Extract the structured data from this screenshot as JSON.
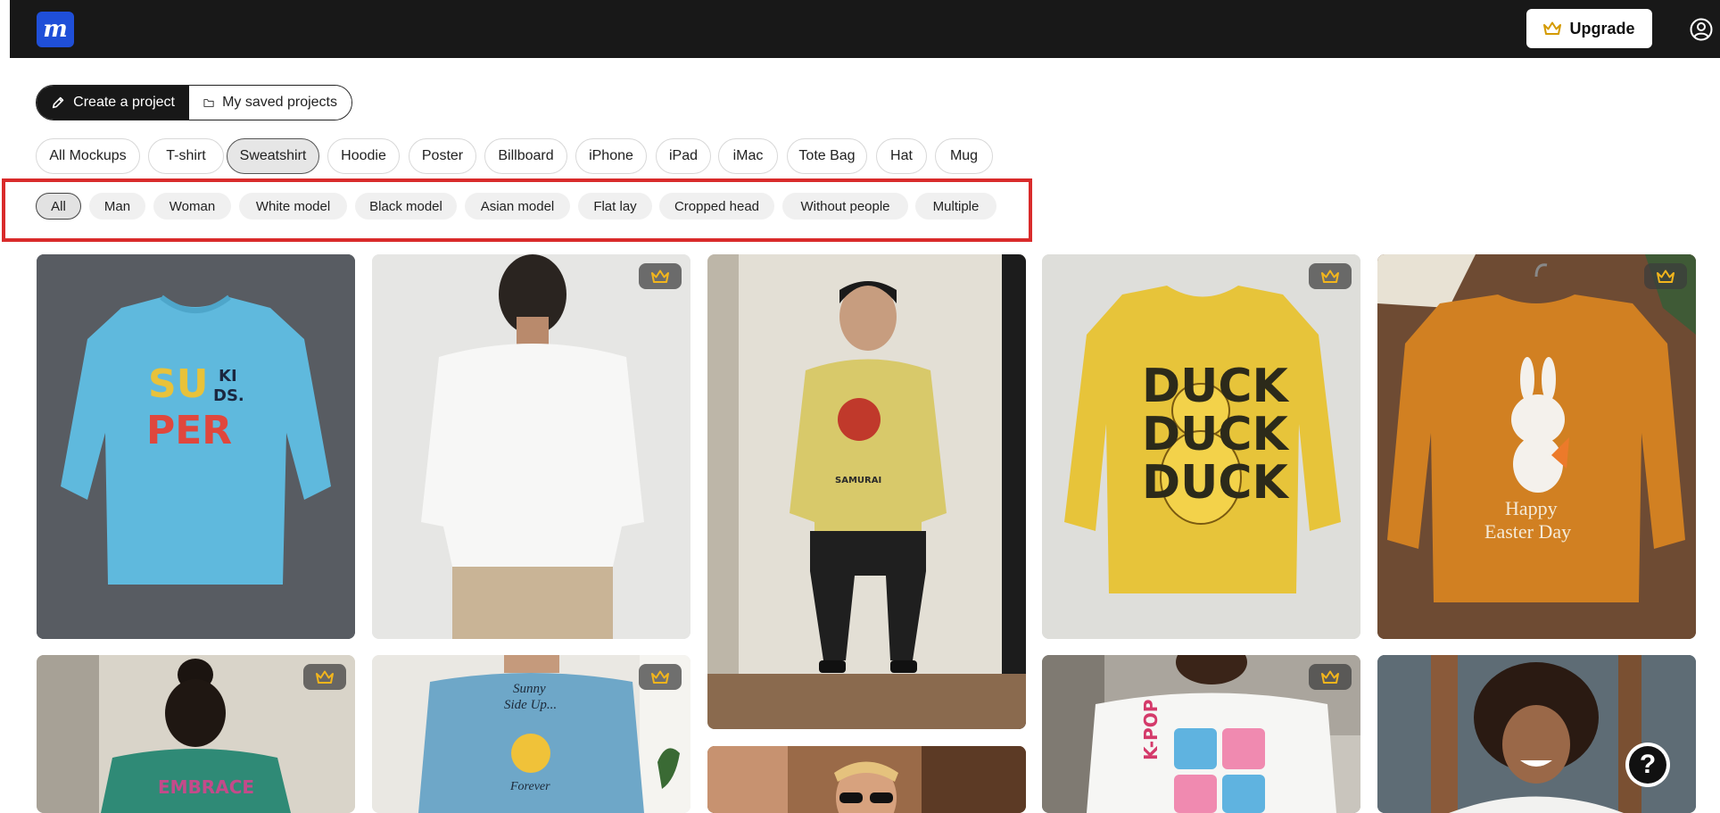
{
  "header": {
    "logo_letter": "m",
    "upgrade_label": "Upgrade",
    "logo_icon": "brand-logo-icon",
    "upgrade_icon": "crown-icon",
    "account_icon": "user-circle-icon"
  },
  "project_tabs": [
    {
      "label": "Create a project",
      "icon": "brush-icon",
      "active": true
    },
    {
      "label": "My saved projects",
      "icon": "folder-icon",
      "active": false
    }
  ],
  "categories": [
    {
      "label": "All Mockups",
      "active": false
    },
    {
      "label": "T-shirt",
      "active": false
    },
    {
      "label": "Sweatshirt",
      "active": true
    },
    {
      "label": "Hoodie",
      "active": false
    },
    {
      "label": "Poster",
      "active": false
    },
    {
      "label": "Billboard",
      "active": false
    },
    {
      "label": "iPhone",
      "active": false
    },
    {
      "label": "iPad",
      "active": false
    },
    {
      "label": "iMac",
      "active": false
    },
    {
      "label": "Tote Bag",
      "active": false
    },
    {
      "label": "Hat",
      "active": false
    },
    {
      "label": "Mug",
      "active": false
    }
  ],
  "filters": [
    {
      "label": "All",
      "active": true
    },
    {
      "label": "Man",
      "active": false
    },
    {
      "label": "Woman",
      "active": false
    },
    {
      "label": "White model",
      "active": false
    },
    {
      "label": "Black model",
      "active": false
    },
    {
      "label": "Asian model",
      "active": false
    },
    {
      "label": "Flat lay",
      "active": false
    },
    {
      "label": "Cropped head",
      "active": false
    },
    {
      "label": "Without people",
      "active": false
    },
    {
      "label": "Multiple",
      "active": false
    }
  ],
  "mockups": [
    {
      "premium": false,
      "description": "light blue sweatshirt flat lay on asphalt"
    },
    {
      "premium": true,
      "description": "white sweatshirt back view man"
    },
    {
      "premium": false,
      "description": "yellow sweatshirt seated man"
    },
    {
      "premium": true,
      "description": "yellow sweatshirt duck print"
    },
    {
      "premium": true,
      "description": "orange sweatshirt on hanger"
    },
    {
      "premium": true,
      "description": "green sweatshirt back view woman"
    },
    {
      "premium": true,
      "description": "blue sweatshirt front view man"
    },
    {
      "premium": false,
      "description": "man with sunglasses"
    },
    {
      "premium": true,
      "description": "white sweatshirt k-pop print"
    },
    {
      "premium": false,
      "description": "woman smiling"
    }
  ],
  "print_text": {
    "card1_line1": "SU",
    "card1_line2": "KI",
    "card1_line3": "DS.",
    "card1_line4": "PER",
    "card3_print": "SAMURAI",
    "card4_line1": "DUCK",
    "card4_line2": "DUCK",
    "card4_line3": "DUCK",
    "card5_line1": "Happy",
    "card5_line2": "Easter Day",
    "card6_print": "EMBRACE",
    "card7_line1": "Sunny",
    "card7_line2": "Side Up...",
    "card7_line3": "Forever",
    "card9_print": "K-POP"
  },
  "help": {
    "label": "?",
    "icon": "help-icon"
  },
  "colors": {
    "topbar": "#181818",
    "brand_blue": "#1f4fd8",
    "highlight_red": "#d92b2b",
    "crown_gold": "#f2b51c"
  }
}
